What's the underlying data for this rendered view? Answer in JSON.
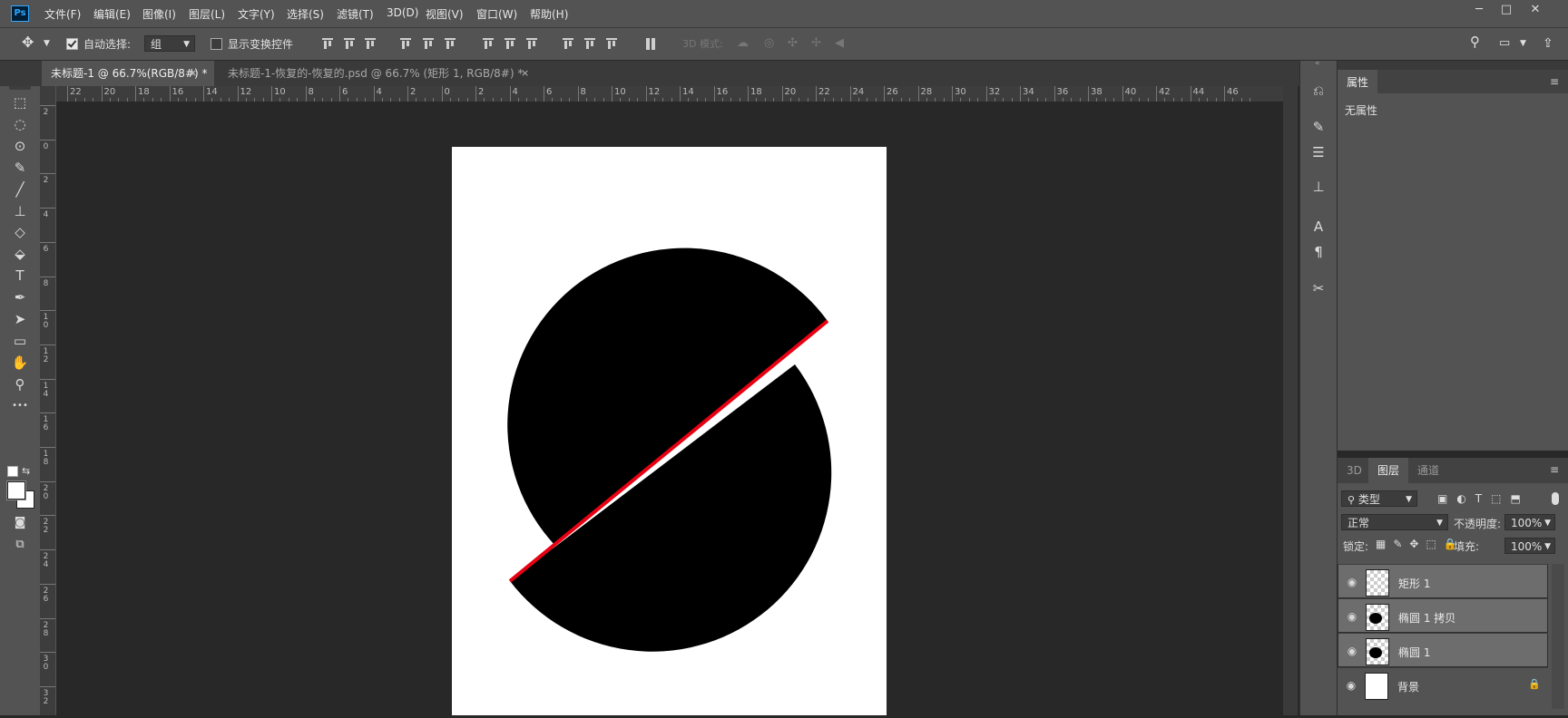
{
  "app": {
    "logo": "Ps"
  },
  "menu": [
    "文件(F)",
    "编辑(E)",
    "图像(I)",
    "图层(L)",
    "文字(Y)",
    "选择(S)",
    "滤镜(T)",
    "3D(D)",
    "视图(V)",
    "窗口(W)",
    "帮助(H)"
  ],
  "window_controls": {
    "minimize": "─",
    "maximize": "□",
    "close": "✕"
  },
  "options": {
    "auto_select_label": "自动选择:",
    "auto_select_checked": true,
    "auto_select_value": "组",
    "show_transform_label": "显示变换控件",
    "show_transform_checked": false,
    "mode_3d_label": "3D 模式:"
  },
  "tabs": [
    {
      "label": "未标题-1 @ 66.7%(RGB/8#) *",
      "active": true
    },
    {
      "label": "未标题-1-恢复的-恢复的.psd @ 66.7% (矩形 1, RGB/8#) *",
      "active": false
    }
  ],
  "tab_close": "×",
  "ruler": {
    "h_labels": [
      "22",
      "20",
      "18",
      "16",
      "14",
      "12",
      "10",
      "8",
      "6",
      "4",
      "2",
      "0",
      "2",
      "4",
      "6",
      "8",
      "10",
      "12",
      "14",
      "16",
      "18",
      "20",
      "22",
      "24",
      "26",
      "28",
      "30",
      "32",
      "34",
      "36",
      "38",
      "40",
      "42",
      "44",
      "46"
    ],
    "v_labels": [
      "2",
      "0",
      "2",
      "4",
      "6",
      "8",
      "1 0",
      "1 2",
      "1 4",
      "1 6",
      "1 8",
      "2 0",
      "2 2",
      "2 4",
      "2 6",
      "2 8",
      "3 0",
      "3 2"
    ]
  },
  "tools": [
    {
      "name": "move-tool-icon",
      "glyph": "✥"
    },
    {
      "name": "marquee-tool-icon",
      "glyph": "⬚"
    },
    {
      "name": "lasso-tool-icon",
      "glyph": "◌"
    },
    {
      "name": "quick-select-tool-icon",
      "glyph": "⊙"
    },
    {
      "name": "eyedropper-tool-icon",
      "glyph": "✎"
    },
    {
      "name": "brush-tool-icon",
      "glyph": "╱"
    },
    {
      "name": "stamp-tool-icon",
      "glyph": "⊥"
    },
    {
      "name": "eraser-tool-icon",
      "glyph": "◇"
    },
    {
      "name": "paint-bucket-tool-icon",
      "glyph": "⬙"
    },
    {
      "name": "type-tool-icon",
      "glyph": "T"
    },
    {
      "name": "pen-tool-icon",
      "glyph": "✒"
    },
    {
      "name": "path-select-tool-icon",
      "glyph": "➤"
    },
    {
      "name": "rectangle-tool-icon",
      "glyph": "▭"
    },
    {
      "name": "hand-tool-icon",
      "glyph": "✋"
    },
    {
      "name": "zoom-tool-icon",
      "glyph": "⚲"
    },
    {
      "name": "more-tools-icon",
      "glyph": "•••"
    }
  ],
  "colors": {
    "foreground": "#ffffff",
    "background": "#ffffff",
    "accent_stroke": "#e60012",
    "shape": "#000000"
  },
  "properties": {
    "title": "属性",
    "empty": "无属性"
  },
  "layers_panel": {
    "tabs": [
      {
        "label": "3D",
        "active": false
      },
      {
        "label": "图层",
        "active": true
      },
      {
        "label": "通道",
        "active": false
      }
    ],
    "filter_label": "类型",
    "blend_mode": "正常",
    "opacity_label": "不透明度:",
    "opacity_value": "100%",
    "lock_label": "锁定:",
    "fill_label": "填充:",
    "fill_value": "100%",
    "layers": [
      {
        "name": "矩形 1",
        "selected": true,
        "thumb": "checker"
      },
      {
        "name": "椭圆 1 拷贝",
        "selected": true,
        "thumb": "checker"
      },
      {
        "name": "椭圆 1",
        "selected": true,
        "thumb": "checker"
      },
      {
        "name": "背景",
        "selected": false,
        "thumb": "white",
        "locked": true
      }
    ]
  }
}
